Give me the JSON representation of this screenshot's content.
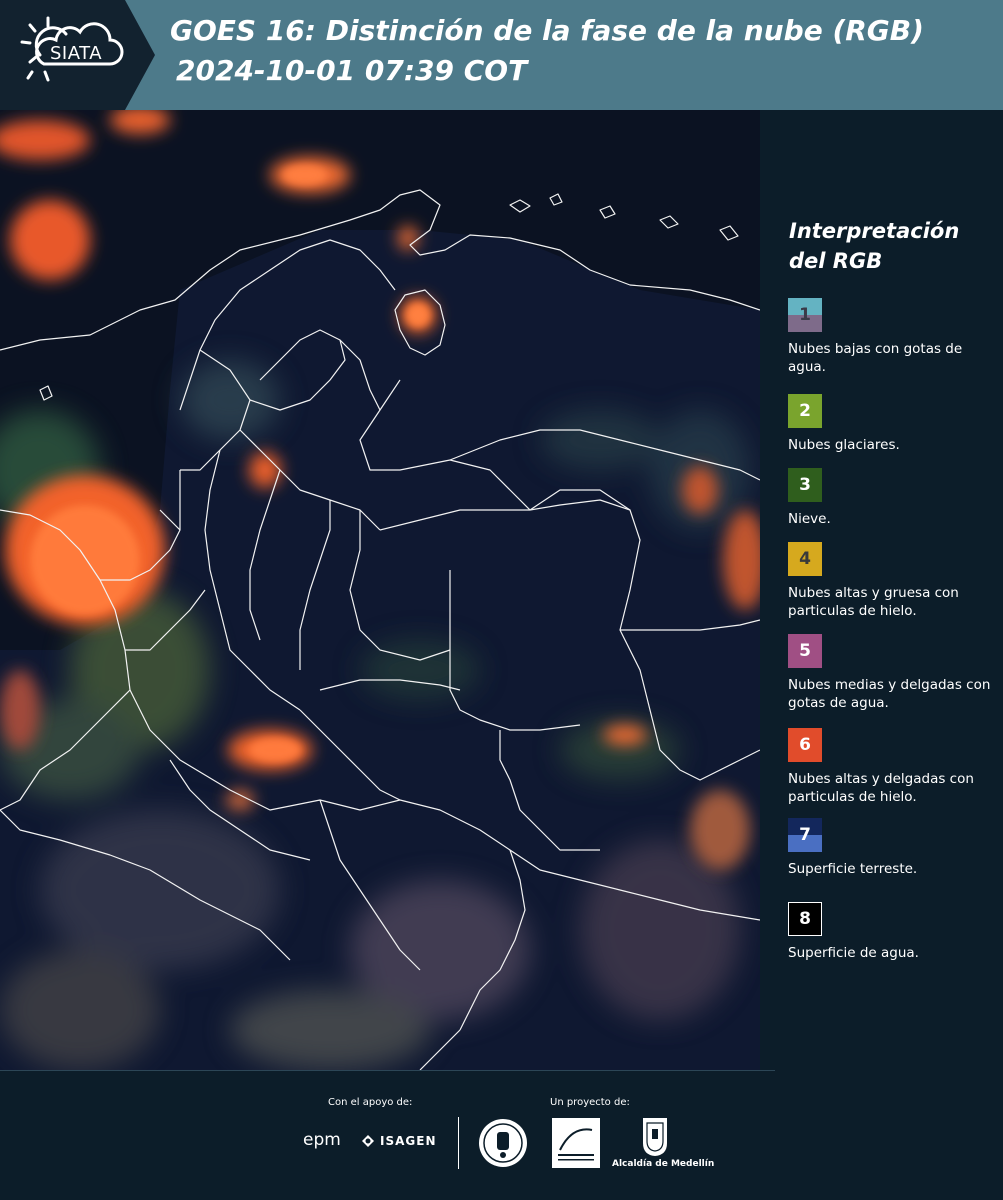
{
  "header": {
    "logo_text": "SIATA",
    "title": "GOES 16: Distinción de la fase de la nube (RGB)",
    "timestamp": "2024-10-01 07:39 COT",
    "background_color": "#4d7a8a"
  },
  "legend": {
    "title_line1": "Interpretación",
    "title_line2": "del RGB",
    "items": [
      {
        "number": "1",
        "label": "Nubes bajas con gotas de agua.",
        "color_top": "#64b3c2",
        "color_bottom": "#7e6b8a",
        "text_color": "#3a3a48"
      },
      {
        "number": "2",
        "label": "Nubes glaciares.",
        "color_top": "#7aa42d",
        "color_bottom": "#7aa42d",
        "text_color": "#ffffff"
      },
      {
        "number": "3",
        "label": "Nieve.",
        "color_top": "#2f5e1d",
        "color_bottom": "#2f5e1d",
        "text_color": "#ffffff"
      },
      {
        "number": "4",
        "label": "Nubes altas y gruesa con particulas de hielo.",
        "color_top": "#d6a91e",
        "color_bottom": "#d6a91e",
        "text_color": "#3a3a3a"
      },
      {
        "number": "5",
        "label": "Nubes medias y delgadas con gotas de agua.",
        "color_top": "#a04f84",
        "color_bottom": "#a04f84",
        "text_color": "#ffffff"
      },
      {
        "number": "6",
        "label": "Nubes altas y delgadas con particulas de hielo.",
        "color_top": "#e14c2b",
        "color_bottom": "#e14c2b",
        "text_color": "#ffffff"
      },
      {
        "number": "7",
        "label": "Superficie terreste.",
        "color_top": "#13275c",
        "color_bottom": "#4a6fc2",
        "text_color": "#ffffff"
      },
      {
        "number": "8",
        "label": "Superficie de agua.",
        "color_top": "#000000",
        "color_bottom": "#000000",
        "text_color": "#ffffff"
      }
    ]
  },
  "footer": {
    "support_label": "Con el apoyo de:",
    "project_label": "Un proyecto de:",
    "epm": "epm",
    "isagen": "ISAGEN",
    "medellin": "Alcaldía de Medellín"
  },
  "map": {
    "icons": [
      "siata-sun-cloud-icon",
      "epm-logo",
      "isagen-icon",
      "university-seal",
      "area-metropolitana-logo",
      "alcaldia-medellin-shield-icon"
    ]
  }
}
